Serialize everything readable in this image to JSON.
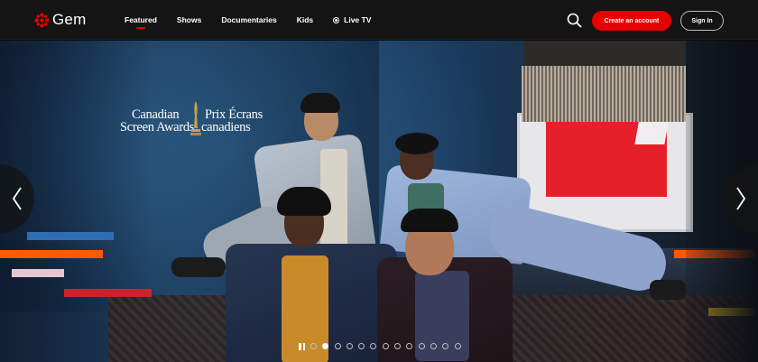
{
  "brand": {
    "name": "Gem",
    "logo_color": "#e60000"
  },
  "nav": {
    "links": [
      {
        "label": "Featured",
        "active": true
      },
      {
        "label": "Shows",
        "active": false
      },
      {
        "label": "Documentaries",
        "active": false
      },
      {
        "label": "Kids",
        "active": false
      },
      {
        "label": "Live TV",
        "active": false
      }
    ],
    "search_icon": "search-icon",
    "create_account_label": "Create an account",
    "sign_in_label": "Sign In",
    "accent_color": "#e60000"
  },
  "hero": {
    "award_logo": {
      "line1_en": "Canadian",
      "line1_fr": "Prix Écrans",
      "line2_en": "Screen Awards",
      "line2_fr": "canadiens"
    },
    "stripe_colors": [
      "#2f6eb1",
      "#ff5a00",
      "#e8c6cf",
      "#c8242e",
      "#ff5a00",
      "#b8a11e"
    ]
  },
  "carousel": {
    "prev_icon": "chevron-left-icon",
    "next_icon": "chevron-right-icon",
    "pause_icon": "pause-icon",
    "slide_count": 13,
    "active_index": 1
  }
}
